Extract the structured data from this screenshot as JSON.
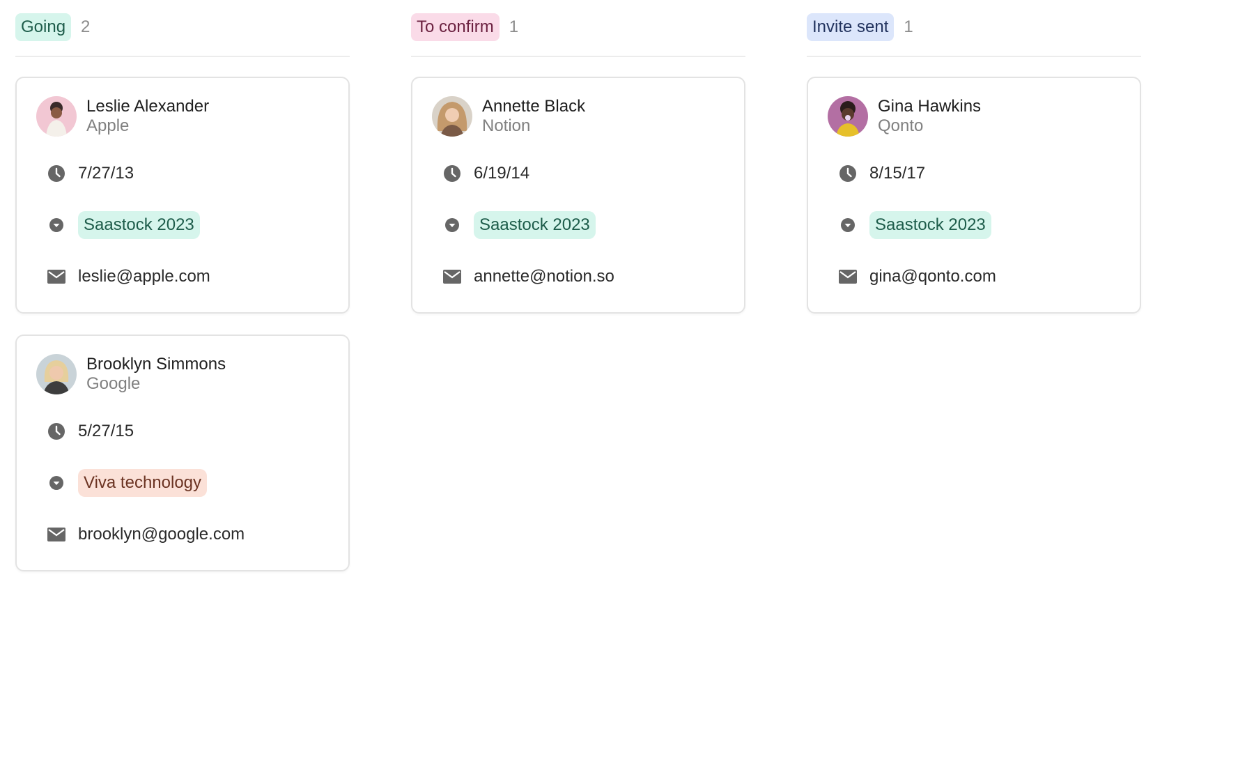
{
  "colors": {
    "going_bg": "#d6f5ec",
    "going_fg": "#1d5c4a",
    "confirm_bg": "#fadbe8",
    "confirm_fg": "#6b2140",
    "invite_bg": "#dce6fb",
    "invite_fg": "#23345f",
    "saastock_bg": "#d6f5ec",
    "saastock_fg": "#1d5c4a",
    "viva_bg": "#fbe1d8",
    "viva_fg": "#6b3322",
    "icon": "#666666"
  },
  "columns": [
    {
      "status": "Going",
      "count": "2",
      "cards": [
        {
          "name": "Leslie Alexander",
          "company": "Apple",
          "date": "7/27/13",
          "event": "Saastock 2023",
          "email": "leslie@apple.com"
        },
        {
          "name": "Brooklyn Simmons",
          "company": "Google",
          "date": "5/27/15",
          "event": "Viva technology",
          "email": "brooklyn@google.com"
        }
      ]
    },
    {
      "status": "To confirm",
      "count": "1",
      "cards": [
        {
          "name": "Annette Black",
          "company": "Notion",
          "date": "6/19/14",
          "event": "Saastock 2023",
          "email": "annette@notion.so"
        }
      ]
    },
    {
      "status": "Invite sent",
      "count": "1",
      "cards": [
        {
          "name": "Gina Hawkins",
          "company": "Qonto",
          "date": "8/15/17",
          "event": "Saastock 2023",
          "email": "gina@qonto.com"
        }
      ]
    }
  ],
  "icons": {
    "date": "clock-icon",
    "event": "chevron-down-circle-icon",
    "email": "envelope-icon"
  }
}
